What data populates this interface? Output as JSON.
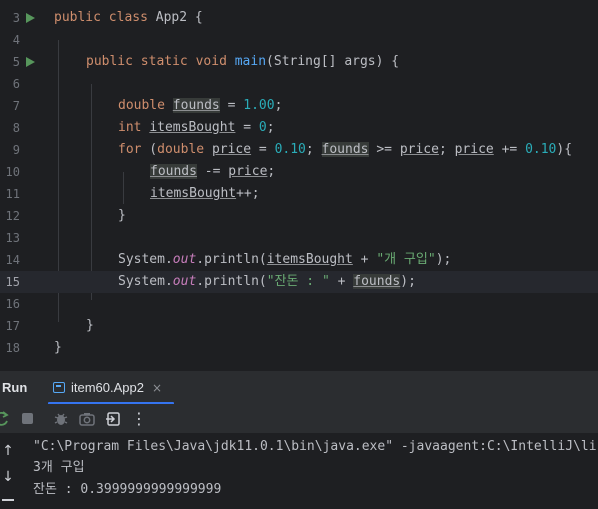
{
  "editor": {
    "lines": [
      {
        "number": "3",
        "top": 0,
        "current": false,
        "run_marker": false,
        "indent": 0,
        "tokens": []
      },
      {
        "number": "4",
        "top": 0,
        "current": false,
        "run_marker": false,
        "indent": 0,
        "tokens": []
      }
    ],
    "line_numbers": [
      "3",
      "4",
      "5",
      "6",
      "7",
      "8",
      "9",
      "10",
      "11",
      "12",
      "13",
      "14",
      "15",
      "16",
      "17",
      "18"
    ],
    "top_line_number": "3",
    "code": {
      "l3": {
        "num": "3",
        "kw_public": "public",
        "kw_class": "class",
        "name": "App2 {"
      },
      "l4": {
        "num": "4"
      },
      "l5": {
        "num": "5",
        "kw_public": "public",
        "kw_static": "static",
        "kw_void": "void",
        "fn": "main",
        "rest": "(String[] args) {"
      },
      "l6": {
        "num": "6"
      },
      "l7": {
        "num": "7",
        "kw": "double",
        "var": "founds",
        "op": " = ",
        "val": "1.00",
        "end": ";"
      },
      "l8": {
        "num": "8",
        "kw": "int",
        "var": "itemsBought",
        "op": " = ",
        "val": "0",
        "end": ";"
      },
      "l9": {
        "num": "9",
        "kw_for": "for",
        "p1": " (",
        "kw_double": "double",
        "sp": " ",
        "v_price1": "price",
        "op1": " = ",
        "n1": "0.10",
        "semi1": "; ",
        "v_founds": "founds",
        "op2": " >= ",
        "v_price2": "price",
        "semi2": "; ",
        "v_price3": "price",
        "op3": " += ",
        "n2": "0.10",
        "end": "){"
      },
      "l10": {
        "num": "10",
        "var": "founds",
        "op": " -= ",
        "var2": "price",
        "end": ";"
      },
      "l11": {
        "num": "11",
        "var": "itemsBought",
        "end": "++;"
      },
      "l12": {
        "num": "12",
        "brace": "}"
      },
      "l13": {
        "num": "13"
      },
      "l14": {
        "num": "14",
        "cls": "System.",
        "stat": "out",
        "method": ".println(",
        "var": "itemsBought",
        "op": " + ",
        "str": "\"개 구입\"",
        "end": ");"
      },
      "l15": {
        "num": "15",
        "cls": "System.",
        "stat": "out",
        "method": ".println(",
        "str": "\"잔돈 : \"",
        "op": " + ",
        "var": "founds",
        "end": ");"
      },
      "l16": {
        "num": "16"
      },
      "l17": {
        "num": "17",
        "brace": "}"
      },
      "l18": {
        "num": "18",
        "brace": "}"
      }
    }
  },
  "run_window": {
    "title": "Run",
    "tab_label": "item60.App2",
    "tab_close": "×",
    "more": "⋮",
    "up_arrow": "↑",
    "down_arrow": "↓"
  },
  "console": {
    "lines": [
      "\"C:\\Program Files\\Java\\jdk11.0.1\\bin\\java.exe\" -javaagent:C:\\IntelliJ\\li",
      "3개 구입",
      "잔돈 : 0.3999999999999999"
    ]
  },
  "colors": {
    "background": "#1e1f22",
    "keyword": "#cf8e6d",
    "number": "#2aacb8",
    "function": "#56a8f5",
    "string": "#6aab73",
    "static_field": "#c77dbb",
    "run_marker": "#57965c",
    "tab_underline": "#3574f0"
  }
}
